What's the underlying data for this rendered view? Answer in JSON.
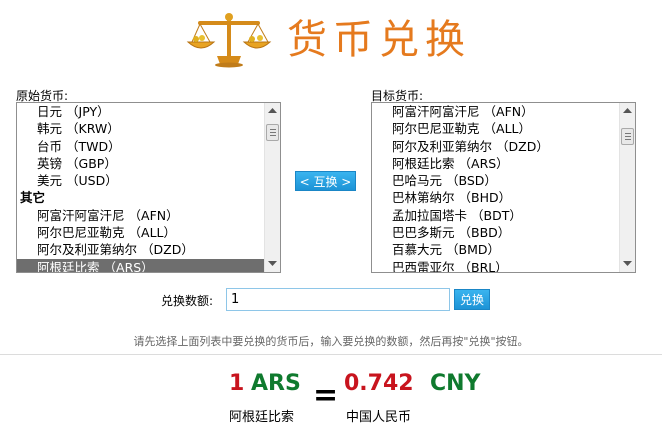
{
  "header": {
    "title": "货币兑换",
    "logo_icon": "balance-scale-icon"
  },
  "source_list": {
    "label": "原始货币:",
    "items": [
      {
        "name": "日元",
        "code": "（JPY）",
        "group": false,
        "selected": false
      },
      {
        "name": "韩元",
        "code": "（KRW）",
        "group": false,
        "selected": false
      },
      {
        "name": "台币",
        "code": "（TWD）",
        "group": false,
        "selected": false
      },
      {
        "name": "英镑",
        "code": "（GBP）",
        "group": false,
        "selected": false
      },
      {
        "name": "美元",
        "code": "（USD）",
        "group": false,
        "selected": false
      },
      {
        "name": "其它",
        "code": "",
        "group": true,
        "selected": false
      },
      {
        "name": "阿富汗阿富汗尼",
        "code": "（AFN）",
        "group": false,
        "selected": false
      },
      {
        "name": "阿尔巴尼亚勒克",
        "code": "（ALL）",
        "group": false,
        "selected": false
      },
      {
        "name": "阿尔及利亚第纳尔",
        "code": "（DZD）",
        "group": false,
        "selected": false
      },
      {
        "name": "阿根廷比索",
        "code": "（ARS）",
        "group": false,
        "selected": true
      }
    ]
  },
  "target_list": {
    "label": "目标货币:",
    "items": [
      {
        "name": "阿富汗阿富汗尼",
        "code": "（AFN）",
        "group": false,
        "selected": false
      },
      {
        "name": "阿尔巴尼亚勒克",
        "code": "（ALL）",
        "group": false,
        "selected": false
      },
      {
        "name": "阿尔及利亚第纳尔",
        "code": "（DZD）",
        "group": false,
        "selected": false
      },
      {
        "name": "阿根廷比索",
        "code": "（ARS）",
        "group": false,
        "selected": false
      },
      {
        "name": "巴哈马元",
        "code": "（BSD）",
        "group": false,
        "selected": false
      },
      {
        "name": "巴林第纳尔",
        "code": "（BHD）",
        "group": false,
        "selected": false
      },
      {
        "name": "孟加拉国塔卡",
        "code": "（BDT）",
        "group": false,
        "selected": false
      },
      {
        "name": "巴巴多斯元",
        "code": "（BBD）",
        "group": false,
        "selected": false
      },
      {
        "name": "百慕大元",
        "code": "（BMD）",
        "group": false,
        "selected": false
      },
      {
        "name": "巴西雷亚尔",
        "code": "（BRL）",
        "group": false,
        "selected": false
      }
    ]
  },
  "swap_button": {
    "label": "< 互换 >"
  },
  "amount": {
    "label": "兑换数额:",
    "value": "1"
  },
  "convert_button": {
    "label": "兑换"
  },
  "hint": "请先选择上面列表中要兑换的货币后，输入要兑换的数额，然后再按\"兑换\"按钮。",
  "result": {
    "from_amount": "1",
    "from_code": "ARS",
    "equals": "=",
    "to_amount": "0.742",
    "to_code": "CNY",
    "from_name": "阿根廷比索",
    "to_name": "中国人民币"
  },
  "colors": {
    "title": "#e57a1e",
    "button": "#1d93d6",
    "amount_red": "#c8141e",
    "code_green": "#0f7a2e",
    "selected_bg": "#6e6e6e"
  }
}
